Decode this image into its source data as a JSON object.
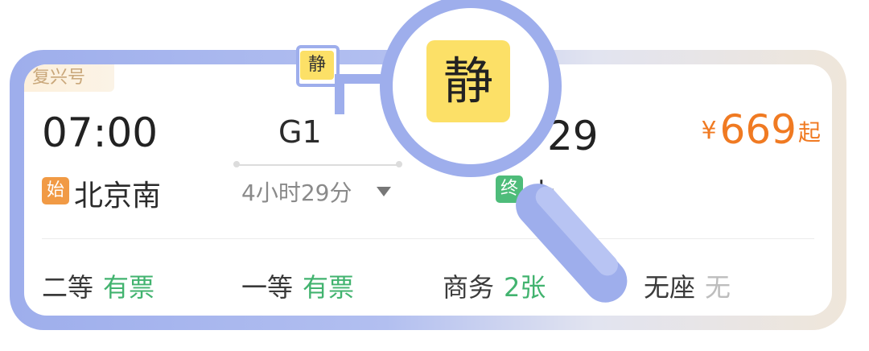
{
  "brand_label": "复兴号",
  "departure": {
    "time": "07:00",
    "station_badge": "始",
    "station": "北京南"
  },
  "train": {
    "number": "G1",
    "quiet_badge": "静",
    "duration": "4小时29分"
  },
  "arrival": {
    "time_visible": "29",
    "station_badge": "终",
    "station_visible": "上"
  },
  "price": {
    "currency": "¥",
    "amount": "669",
    "suffix": "起"
  },
  "seats": [
    {
      "class": "二等",
      "availability": "有票",
      "status": "available"
    },
    {
      "class": "一等",
      "availability": "有票",
      "status": "available"
    },
    {
      "class": "商务",
      "availability": "2张",
      "status": "available"
    },
    {
      "class": "无座",
      "availability": "无",
      "status": "none"
    }
  ],
  "magnifier": {
    "zoomed_badge": "静"
  },
  "colors": {
    "frame": "#9eaeec",
    "price": "#f07a22",
    "available": "#42b36f",
    "start_badge": "#f19a45",
    "end_badge": "#4ebc7a",
    "quiet_badge": "#fce067"
  }
}
